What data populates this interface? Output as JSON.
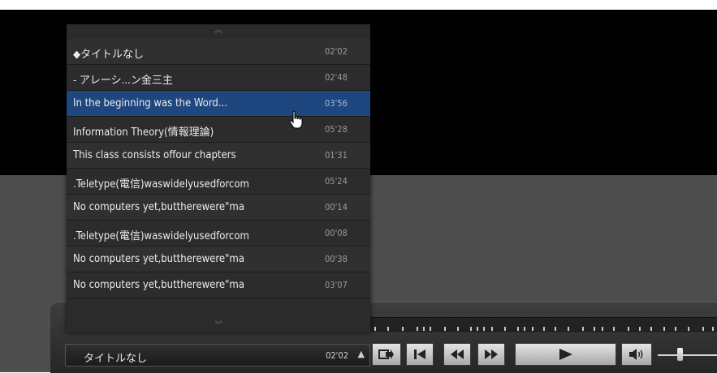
{
  "playlist": {
    "items": [
      {
        "title": "◆タイトルなし",
        "time": "02'02"
      },
      {
        "title": " - アレーシ...ン金三主",
        "time": "02'48"
      },
      {
        "title": "In the beginning was the Word...",
        "time": "03'56"
      },
      {
        "title": "Information Theory(情報理論)",
        "time": "05'28"
      },
      {
        "title": "This class consists offour chapters",
        "time": "01'31"
      },
      {
        "title": ".Teletype(電信)waswidelyusedforcom",
        "time": "05'24"
      },
      {
        "title": "No computers yet,buttherewere\"ma",
        "time": "00'14"
      },
      {
        "title": ".Teletype(電信)waswidelyusedforcom",
        "time": "00'08"
      },
      {
        "title": "No computers yet,buttherewere\"ma",
        "time": "00'38"
      },
      {
        "title": "No computers yet,buttherewere\"ma",
        "time": "03'07"
      }
    ],
    "selected_index": 2
  },
  "bottom_bar": {
    "title": "タイトルなし",
    "time": "02'02"
  },
  "icons": {
    "scroll_up": "double-chevron-up-icon",
    "scroll_down": "double-chevron-down-icon",
    "playlist_toggle": "triangle-up-icon",
    "export": "export-arrow-icon",
    "previous": "skip-previous-icon",
    "rewind": "rewind-icon",
    "fast_forward": "fast-forward-icon",
    "play": "play-icon",
    "volume": "speaker-icon"
  },
  "colors": {
    "selected_row": "#1e467f",
    "video_background": "#000000"
  }
}
